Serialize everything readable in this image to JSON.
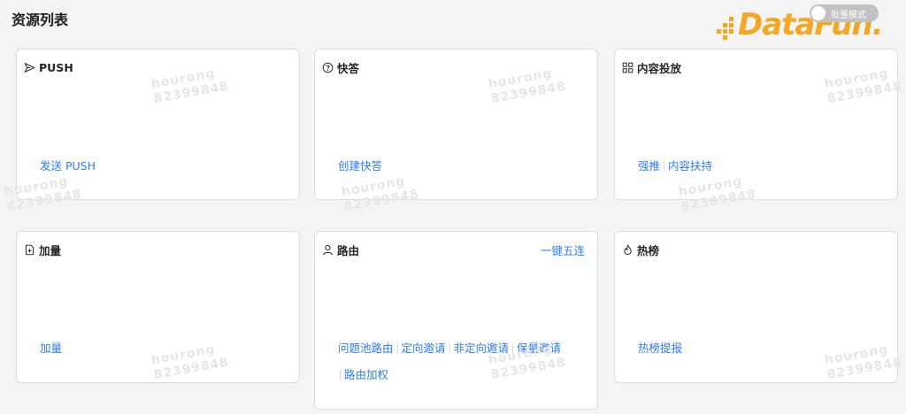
{
  "header": {
    "title": "资源列表",
    "batch_toggle": {
      "label": "批量模式",
      "on": false
    },
    "logo_text": "DataFun."
  },
  "watermark": {
    "line1": "hourong",
    "line2": "82399848"
  },
  "cards": {
    "push": {
      "title": "PUSH",
      "icon": "send-icon",
      "links": [
        "发送 PUSH"
      ]
    },
    "kuaida": {
      "title": "快答",
      "icon": "question-circle-icon",
      "links": [
        "创建快答"
      ]
    },
    "content": {
      "title": "内容投放",
      "icon": "grid-icon",
      "links": [
        "强推",
        "内容扶持"
      ]
    },
    "boost": {
      "title": "加量",
      "icon": "file-plus-icon",
      "links": [
        "加量"
      ]
    },
    "routing": {
      "title": "路由",
      "icon": "user-icon",
      "extra": "一键五连",
      "links_row1": [
        "问题池路由",
        "定向邀请",
        "非定向邀请",
        "保量邀请"
      ],
      "links_row2": [
        "路由加权"
      ]
    },
    "hot": {
      "title": "热榜",
      "icon": "flame-icon",
      "links": [
        "热榜提报"
      ]
    }
  },
  "colors": {
    "link": "#2f7bf0",
    "logo": "#f5a623",
    "toggle": "#c2c2c2",
    "background": "#f4f4f5"
  }
}
